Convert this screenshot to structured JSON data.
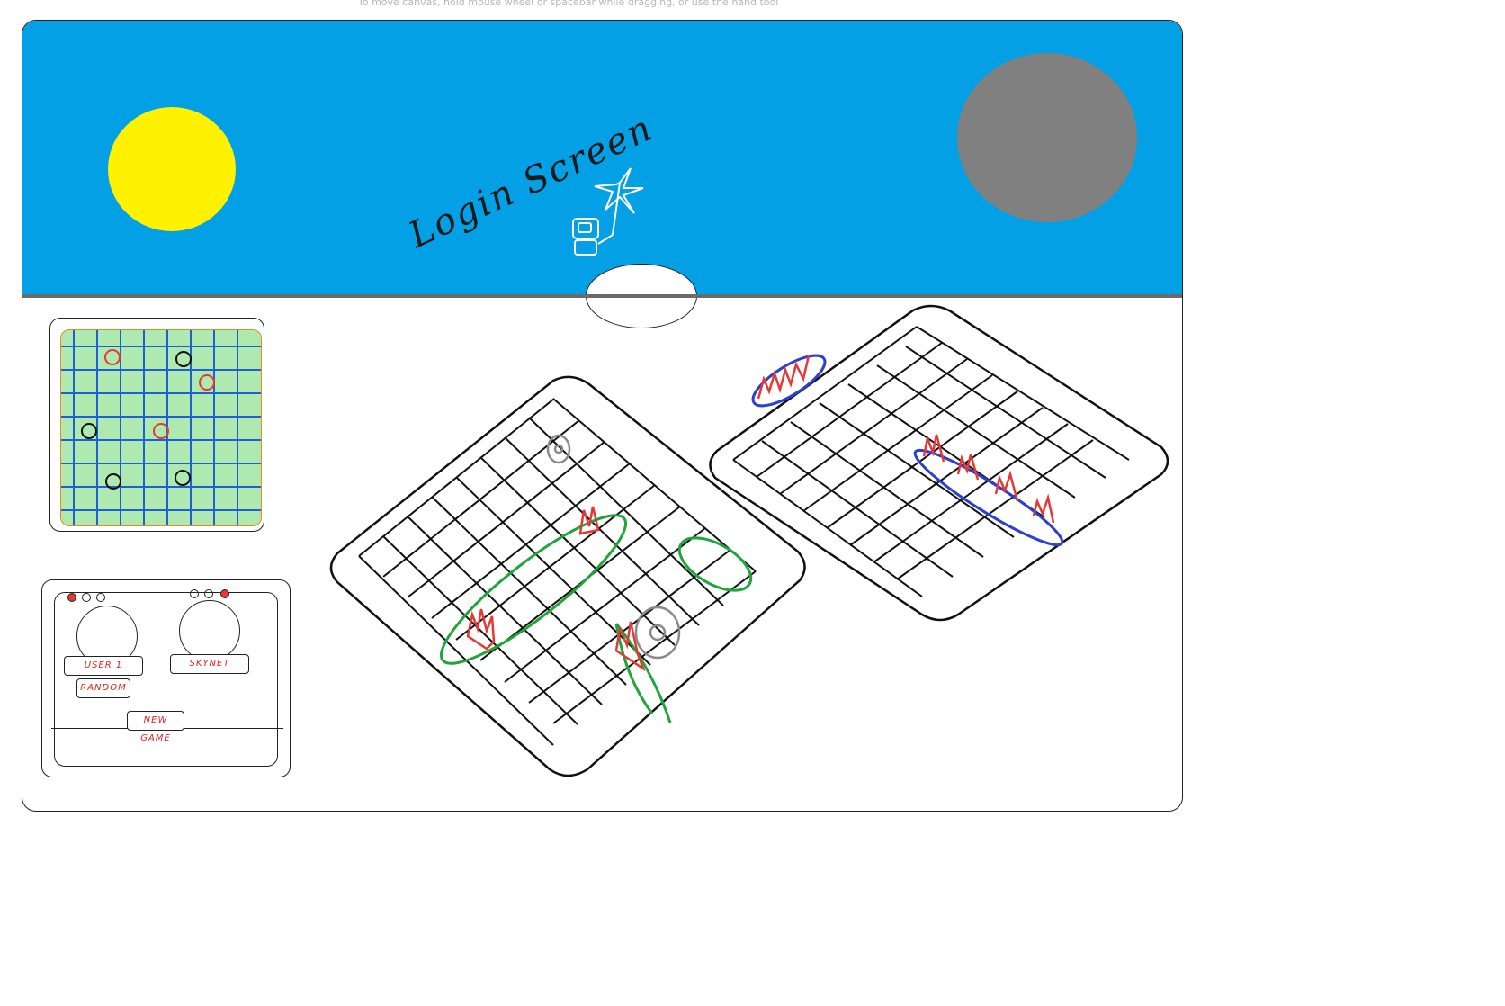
{
  "canvas_hint": "To move canvas, hold mouse wheel or spacebar while dragging, or use the hand tool",
  "sky": {
    "scribble_text": "Login Screen",
    "colors": {
      "sky": "#03a0e6",
      "sun": "#fff200",
      "moon": "#808080",
      "ground_line": "#6b6b6b"
    }
  },
  "minimap": {
    "grid_color": "#1f5fd6",
    "fill_color": "#aee9b0",
    "border_color": "#e98a25",
    "hit_color": "#e53935",
    "miss_color": "#111111"
  },
  "controls": {
    "user_button": "USER 1",
    "skynet_button": "SKYNET",
    "random_button": "RANDOM",
    "new_game_button": "NEW GAME",
    "label_color": "#e02020"
  },
  "boards": {
    "player_ship_color": "#1fa53a",
    "enemy_ship_color": "#2d3fd0",
    "fire_color": "#e53935"
  }
}
